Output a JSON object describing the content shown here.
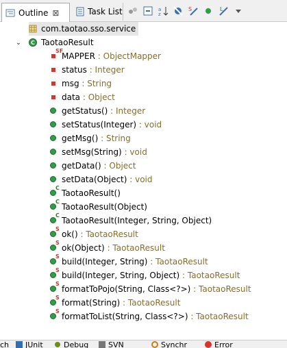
{
  "tabs": {
    "outline": "Outline",
    "task_list": "Task List"
  },
  "tree": {
    "package": "com.taotao.sso.service",
    "class_name": "TaotaoResult",
    "members": [
      {
        "name": "MAPPER",
        "type": " : ObjectMapper",
        "icon": "static-final-field-icon"
      },
      {
        "name": "status",
        "type": " : Integer",
        "icon": "private-field-icon"
      },
      {
        "name": "msg",
        "type": " : String",
        "icon": "private-field-icon"
      },
      {
        "name": "data",
        "type": " : Object",
        "icon": "private-field-icon"
      },
      {
        "name": "getStatus()",
        "type": " : Integer",
        "icon": "public-method-icon"
      },
      {
        "name": "setStatus(Integer)",
        "type": " : void",
        "icon": "public-method-icon"
      },
      {
        "name": "getMsg()",
        "type": " : String",
        "icon": "public-method-icon"
      },
      {
        "name": "setMsg(String)",
        "type": " : void",
        "icon": "public-method-icon"
      },
      {
        "name": "getData()",
        "type": " : Object",
        "icon": "public-method-icon"
      },
      {
        "name": "setData(Object)",
        "type": " : void",
        "icon": "public-method-icon"
      },
      {
        "name": "TaotaoResult()",
        "type": "",
        "icon": "constructor-icon"
      },
      {
        "name": "TaotaoResult(Object)",
        "type": "",
        "icon": "constructor-icon"
      },
      {
        "name": "TaotaoResult(Integer, String, Object)",
        "type": "",
        "icon": "constructor-icon"
      },
      {
        "name": "ok()",
        "type": " : TaotaoResult",
        "icon": "static-method-icon"
      },
      {
        "name": "ok(Object)",
        "type": " : TaotaoResult",
        "icon": "static-method-icon"
      },
      {
        "name": "build(Integer, String)",
        "type": " : TaotaoResult",
        "icon": "static-method-icon"
      },
      {
        "name": "build(Integer, String, Object)",
        "type": " : TaotaoResult",
        "icon": "static-method-icon"
      },
      {
        "name": "formatToPojo(String, Class<?>)",
        "type": " : TaotaoResult",
        "icon": "static-method-icon"
      },
      {
        "name": "format(String)",
        "type": " : TaotaoResult",
        "icon": "static-method-icon"
      },
      {
        "name": "formatToList(String, Class<?>)",
        "type": " : TaotaoResult",
        "icon": "static-method-icon"
      }
    ]
  },
  "bottom_tabs": [
    "ch",
    "JUnit",
    "Debug",
    "SVN",
    "Synchr",
    "Error"
  ],
  "colors": {
    "type_text": "#8a6d1f",
    "method_green": "#2f9e44",
    "field_red": "#d9342b"
  }
}
